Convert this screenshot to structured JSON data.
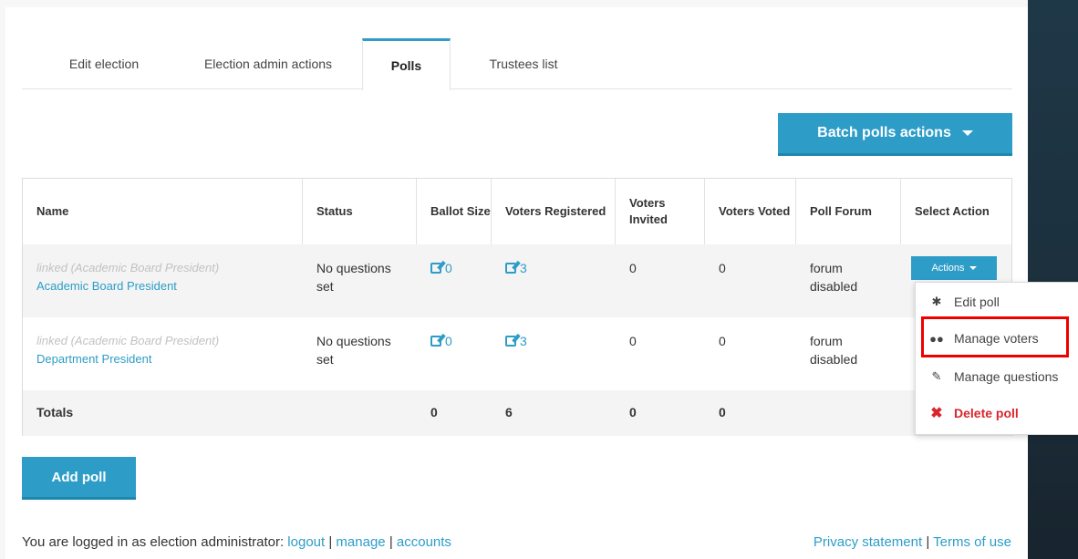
{
  "tabs": [
    {
      "label": "Edit election",
      "active": false
    },
    {
      "label": "Election admin actions",
      "active": false
    },
    {
      "label": "Polls",
      "active": true
    },
    {
      "label": "Trustees list",
      "active": false
    }
  ],
  "batch_button": {
    "label": "Batch polls actions"
  },
  "table": {
    "headers": {
      "name": "Name",
      "status": "Status",
      "ballot_size": "Ballot Size",
      "voters_registered": "Voters Registered",
      "voters_invited": "Voters Invited",
      "voters_voted": "Voters Voted",
      "poll_forum": "Poll Forum",
      "select_action": "Select Action"
    },
    "rows": [
      {
        "linked": "linked (Academic Board President)",
        "name": "Academic Board President",
        "status": "No questions set",
        "ballot_size": "0",
        "voters_registered": "3",
        "voters_invited": "0",
        "voters_voted": "0",
        "poll_forum": "forum disabled"
      },
      {
        "linked": "linked (Academic Board President)",
        "name": "Department President",
        "status": "No questions set",
        "ballot_size": "0",
        "voters_registered": "3",
        "voters_invited": "0",
        "voters_voted": "0",
        "poll_forum": "forum disabled"
      }
    ],
    "totals": {
      "label": "Totals",
      "ballot_size": "0",
      "voters_registered": "6",
      "voters_invited": "0",
      "voters_voted": "0"
    }
  },
  "actions_button": {
    "label": "Actions"
  },
  "dropdown": {
    "items": [
      {
        "label": "Edit poll",
        "icon": "gear-icon"
      },
      {
        "label": "Manage voters",
        "icon": "users-icon"
      },
      {
        "label": "Manage questions",
        "icon": "edit-icon"
      },
      {
        "label": "Delete poll",
        "icon": "close-icon"
      }
    ]
  },
  "add_poll_button": {
    "label": "Add poll"
  },
  "footer": {
    "logged_in_text": "You are logged in as election administrator:",
    "logout": "logout",
    "manage": "manage",
    "accounts": "accounts",
    "separator": "|",
    "privacy": "Privacy statement",
    "terms": "Terms of use"
  },
  "colors": {
    "accent": "#2d9dc8",
    "danger": "#d9262c",
    "highlight": "#ee0000"
  }
}
